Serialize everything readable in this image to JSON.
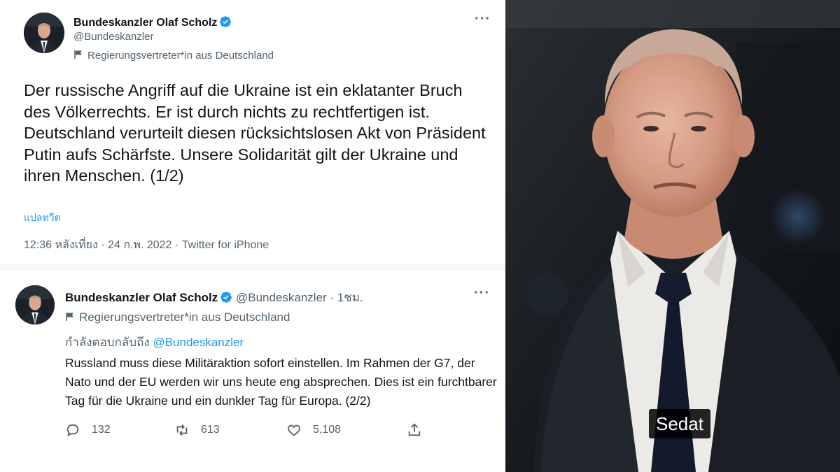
{
  "tweet1": {
    "author_name": "Bundeskanzler Olaf Scholz",
    "handle": "@Bundeskanzler",
    "gov_label": "Regierungsvertreter*in aus Deutschland",
    "body": "Der russische Angriff auf die Ukraine ist ein eklatanter Bruch des Völkerrechts. Er ist durch nichts zu rechtfertigen ist. Deutschland verurteilt diesen rücksichtslosen Akt von Präsident Putin aufs Schärfste. Unsere Solidarität gilt der Ukraine und ihren Menschen. (1/2)",
    "translate_label": "แปลทวีต",
    "meta": "12:36 หลังเที่ยง · 24 ก.พ. 2022 · Twitter for iPhone",
    "more_label": "···"
  },
  "tweet2": {
    "author_name": "Bundeskanzler Olaf Scholz",
    "handle_time": "@Bundeskanzler · 1ชม.",
    "gov_label": "Regierungsvertreter*in aus Deutschland",
    "reply_prefix": "กำลังตอบกลับถึง",
    "reply_mention": "@Bundeskanzler",
    "body": "Russland muss diese Militäraktion sofort einstellen. Im Rahmen der G7, der Nato und der EU werden wir uns heute eng absprechen. Dies ist ein furchtbarer Tag für die Ukraine und ein dunkler Tag für Europa. (2/2)",
    "more_label": "···",
    "actions": {
      "replies": "132",
      "retweets": "613",
      "likes": "5,108"
    }
  },
  "video": {
    "subtitle": "Sedat"
  },
  "colors": {
    "accent": "#1d9bf0",
    "secondary_text": "#536471",
    "primary_text": "#0f1419"
  },
  "icons": [
    "verified-badge-icon",
    "flag-icon",
    "reply-icon",
    "retweet-icon",
    "like-icon",
    "share-icon",
    "more-icon"
  ]
}
